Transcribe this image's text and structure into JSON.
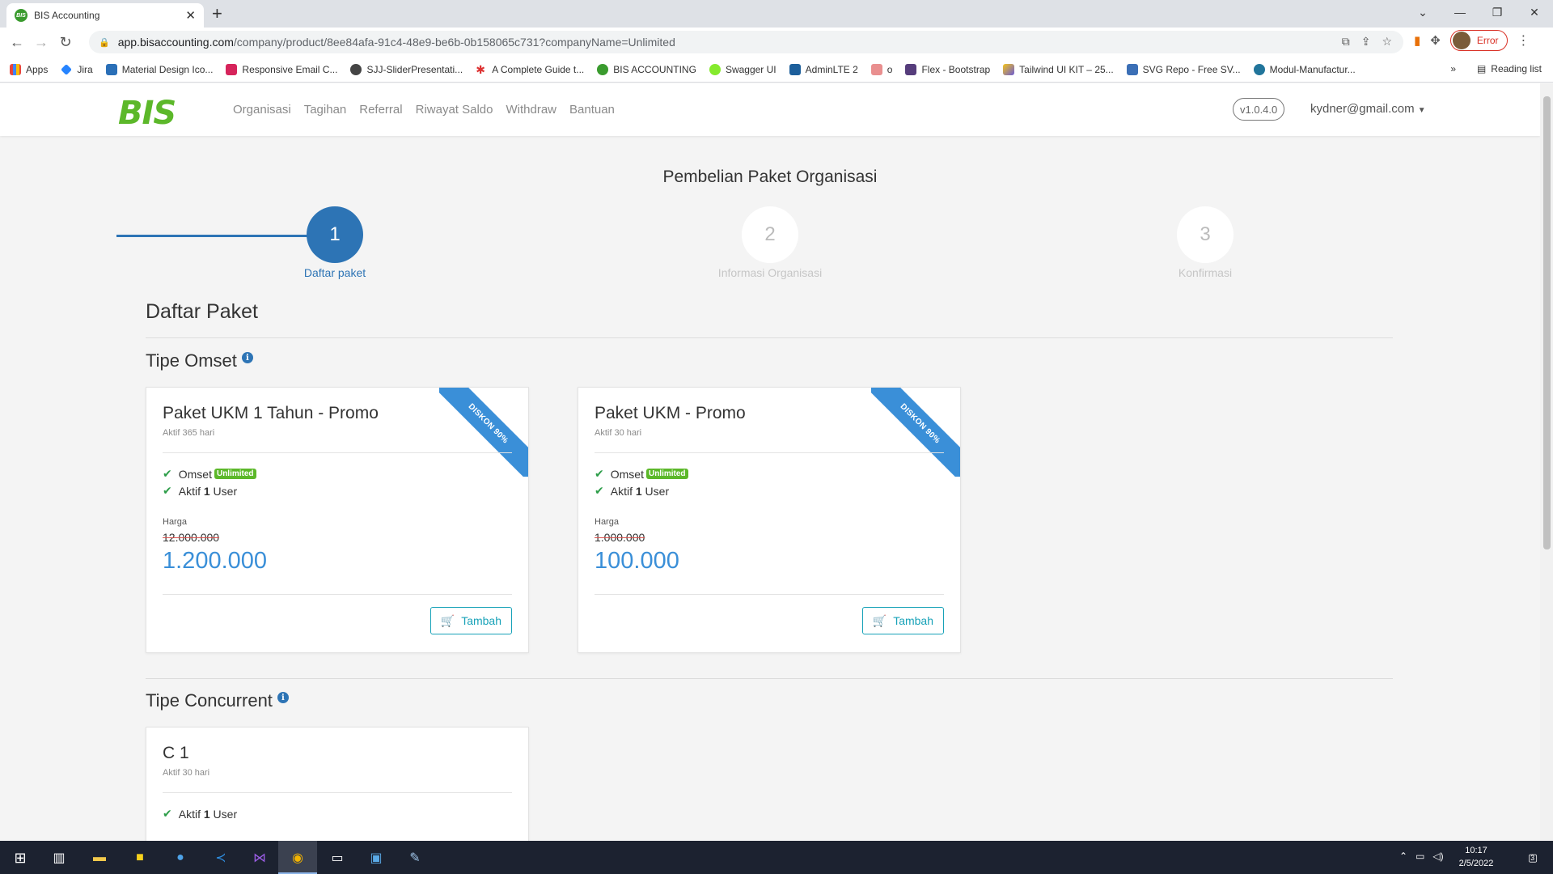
{
  "browser": {
    "tab_title": "BIS Accounting",
    "url_host": "app.bisaccounting.com",
    "url_path": "/company/product/8ee84afa-91c4-48e9-be6b-0b158065c731?companyName=Unlimited",
    "profile_status": "Error",
    "bookmarks": [
      "Apps",
      "Jira",
      "Material Design Ico...",
      "Responsive Email C...",
      "SJJ-SliderPresentati...",
      "A Complete Guide t...",
      "BIS ACCOUNTING",
      "Swagger UI",
      "AdminLTE 2",
      "o",
      "Flex - Bootstrap",
      "Tailwind UI KIT – 25...",
      "SVG Repo - Free SV...",
      "Modul-Manufactur..."
    ],
    "reading_list": "Reading list"
  },
  "app": {
    "logo": "BIS",
    "menu": [
      "Organisasi",
      "Tagihan",
      "Referral",
      "Riwayat Saldo",
      "Withdraw",
      "Bantuan"
    ],
    "version": "v1.0.4.0",
    "user_email": "kydner@gmail.com"
  },
  "page": {
    "title": "Pembelian Paket Organisasi",
    "steps": [
      {
        "number": "1",
        "label": "Daftar paket",
        "state": "active"
      },
      {
        "number": "2",
        "label": "Informasi Organisasi",
        "state": "inactive"
      },
      {
        "number": "3",
        "label": "Konfirmasi",
        "state": "inactive"
      }
    ],
    "section_title": "Daftar Paket",
    "omset": {
      "heading": "Tipe Omset",
      "cards": [
        {
          "name": "Paket UKM 1 Tahun - Promo",
          "duration": "Aktif 365 hari",
          "ribbon": "DISKON 90%",
          "feat_omset": "Omset",
          "badge": "Unlimited",
          "feat_user_prefix": "Aktif",
          "feat_user_count": "1",
          "feat_user_suffix": "User",
          "price_label": "Harga",
          "old_price": "12.000.000",
          "new_price": "1.200.000",
          "button": "Tambah"
        },
        {
          "name": "Paket UKM - Promo",
          "duration": "Aktif 30 hari",
          "ribbon": "DISKON 90%",
          "feat_omset": "Omset",
          "badge": "Unlimited",
          "feat_user_prefix": "Aktif",
          "feat_user_count": "1",
          "feat_user_suffix": "User",
          "price_label": "Harga",
          "old_price": "1.000.000",
          "new_price": "100.000",
          "button": "Tambah"
        }
      ]
    },
    "concurrent": {
      "heading": "Tipe Concurrent",
      "cards": [
        {
          "name": "C 1",
          "duration": "Aktif 30 hari",
          "feat_user_prefix": "Aktif",
          "feat_user_count": "1",
          "feat_user_suffix": "User"
        }
      ]
    }
  },
  "taskbar": {
    "time": "10:17",
    "date": "2/5/2022",
    "notifications": "3"
  },
  "colors": {
    "primary": "#2d74b5",
    "price": "#3a8fd8",
    "logo_green": "#5cb82a",
    "button_teal": "#17a2b8"
  }
}
